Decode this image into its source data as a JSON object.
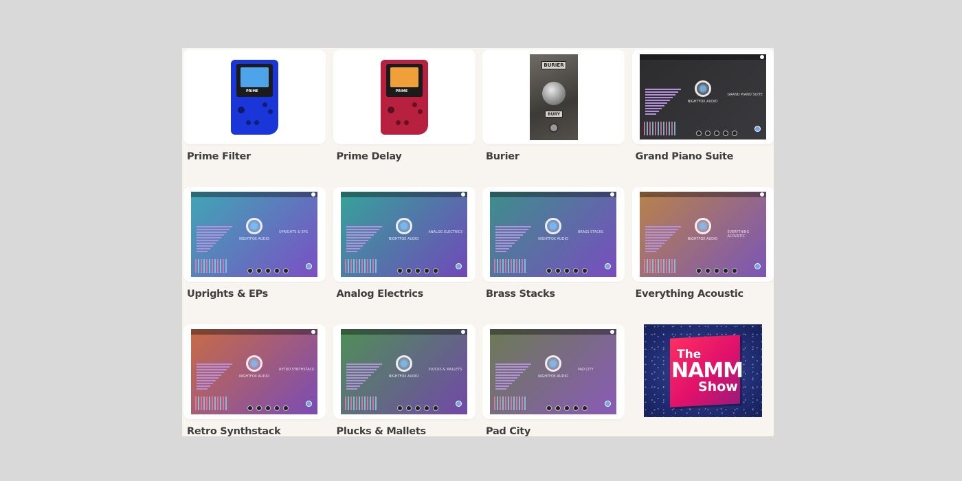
{
  "products": [
    {
      "title": "Prime Filter",
      "kind": "device",
      "color": "#1a36d8",
      "screen": "#4fa3e8",
      "brand": "PRIME"
    },
    {
      "title": "Prime Delay",
      "kind": "device",
      "color": "#b8203f",
      "screen": "#f0a038",
      "brand": "PRIME"
    },
    {
      "title": "Burier",
      "kind": "pedal",
      "plate": "BURIER",
      "plate2": "BURY"
    },
    {
      "title": "Grand Piano Suite",
      "kind": "plugin",
      "name": "GRAND PIANO SUITE",
      "bg": [
        "#2c2c2e",
        "#3a3a3e"
      ],
      "logo": "NIGHTFOX AUDIO"
    },
    {
      "title": "Uprights & EPs",
      "kind": "plugin",
      "name": "UPRIGHTS & EPS",
      "bg": [
        "#3fa6b5",
        "#7b4fc4"
      ],
      "logo": "NIGHTFOX AUDIO"
    },
    {
      "title": "Analog Electrics",
      "kind": "plugin",
      "name": "ANALOG ELECTRICS",
      "bg": [
        "#36a39a",
        "#7048b8"
      ],
      "logo": "NIGHTFOX AUDIO"
    },
    {
      "title": "Brass Stacks",
      "kind": "plugin",
      "name": "BRASS STACKS",
      "bg": [
        "#3d8f8a",
        "#7a4cc0"
      ],
      "logo": "NIGHTFOX AUDIO"
    },
    {
      "title": "Everything Acoustic",
      "kind": "plugin",
      "name": "EVERYTHING ACOUSTIC",
      "bg": [
        "#b9824a",
        "#7a55b8"
      ],
      "logo": "NIGHTFOX AUDIO"
    },
    {
      "title": "Retro Synthstack",
      "kind": "plugin",
      "name": "RETRO SYNTHSTACK",
      "bg": [
        "#c86b46",
        "#7a4cb5"
      ],
      "logo": "NIGHTFOX AUDIO"
    },
    {
      "title": "Plucks & Mallets",
      "kind": "plugin",
      "name": "PLUCKS & MALLETS",
      "bg": [
        "#4f8f57",
        "#7248a8"
      ],
      "logo": "NIGHTFOX AUDIO"
    },
    {
      "title": "Pad City",
      "kind": "plugin",
      "name": "PAD CITY",
      "bg": [
        "#6b7a54",
        "#8a5ab8"
      ],
      "logo": "NIGHTFOX AUDIO"
    }
  ],
  "banner": {
    "line1": "The",
    "line2": "NAMM",
    "line3": "Show"
  }
}
